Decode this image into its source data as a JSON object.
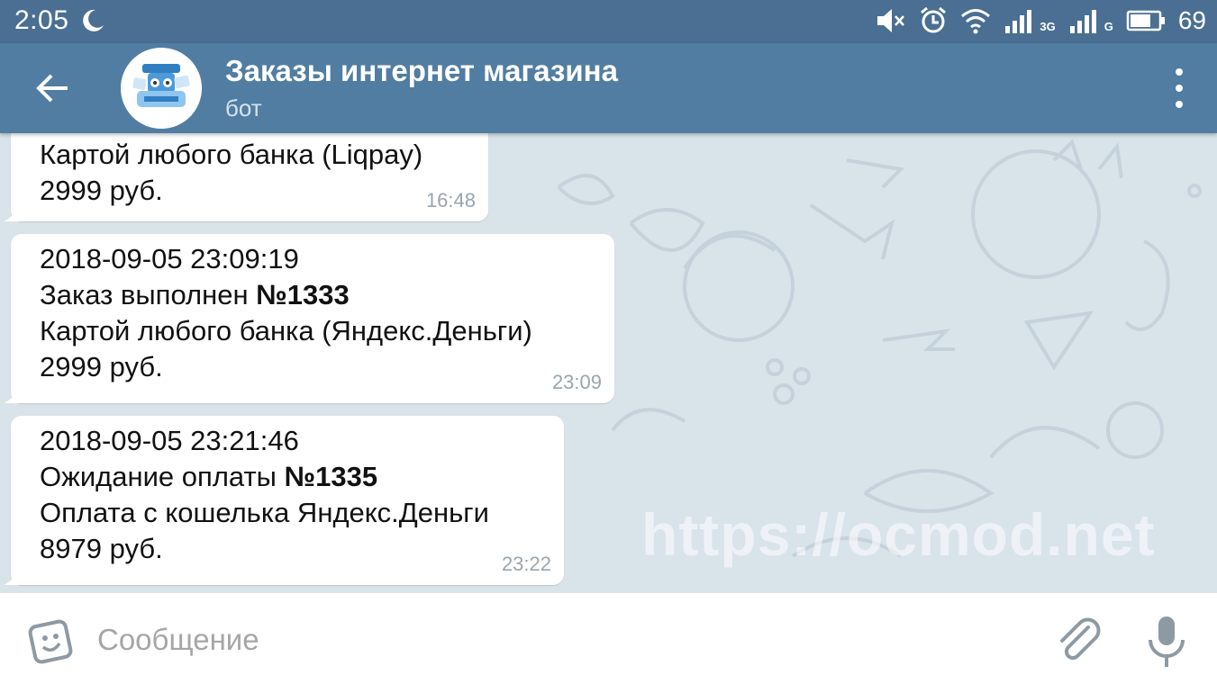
{
  "status_bar": {
    "time": "2:05",
    "network_3g": "3G",
    "network_g": "G",
    "battery_percent": "69",
    "icons": [
      "moon-icon",
      "mute-icon",
      "alarm-icon",
      "wifi-icon",
      "signal-icon",
      "battery-icon"
    ]
  },
  "header": {
    "title": "Заказы интернет магазина",
    "subtitle": "бот",
    "icons": [
      "back-arrow-icon",
      "bot-avatar",
      "more-vert-icon"
    ],
    "colors": {
      "status_bar": "#4a6f93",
      "header": "#517da2"
    }
  },
  "messages": [
    {
      "lines": [
        "Картой любого банка (Liqpay)",
        "2999 руб."
      ],
      "time": "16:48"
    },
    {
      "date": "2018-09-05 23:09:19",
      "status_text": "Заказ выполнен ",
      "order_number": "№1333",
      "payment": "Картой любого банка (Яндекс.Деньги)",
      "amount": "2999 руб.",
      "time": "23:09"
    },
    {
      "date": "2018-09-05 23:21:46",
      "status_text": "Ожидание оплаты ",
      "order_number": "№1335",
      "payment": "Оплата с кошелька Яндекс.Деньги",
      "amount": "8979 руб.",
      "time": "23:22"
    }
  ],
  "watermark": "https://ocmod.net",
  "composer": {
    "placeholder": "Сообщение",
    "value": "",
    "icons": [
      "emoji-icon",
      "paperclip-icon",
      "microphone-icon"
    ]
  }
}
